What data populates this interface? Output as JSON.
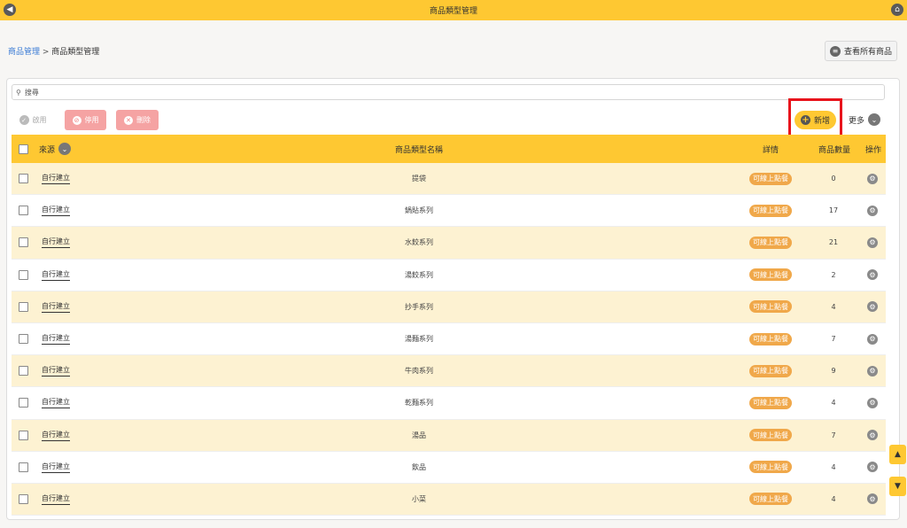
{
  "topbar": {
    "title": "商品類型管理",
    "back_icon": "◀",
    "home_icon": "⌂"
  },
  "breadcrumb": {
    "root": "商品管理",
    "separator": " > ",
    "current": "商品類型管理"
  },
  "view_all_button": {
    "label": "查看所有商品",
    "icon": "≡"
  },
  "search": {
    "placeholder": "搜尋",
    "value": ""
  },
  "toolbar": {
    "enable_label": "啟用",
    "disable_label": "停用",
    "delete_label": "刪除",
    "add_label": "新增",
    "more_label": "更多"
  },
  "table": {
    "headers": {
      "source": "來源",
      "name": "商品類型名稱",
      "detail": "詳情",
      "count": "商品數量",
      "action": "操作"
    },
    "rows": [
      {
        "source": "自行建立",
        "name": "提袋",
        "tag": "可線上點餐",
        "count": "0"
      },
      {
        "source": "自行建立",
        "name": "鍋貼系列",
        "tag": "可線上點餐",
        "count": "17"
      },
      {
        "source": "自行建立",
        "name": "水餃系列",
        "tag": "可線上點餐",
        "count": "21"
      },
      {
        "source": "自行建立",
        "name": "湯餃系列",
        "tag": "可線上點餐",
        "count": "2"
      },
      {
        "source": "自行建立",
        "name": "抄手系列",
        "tag": "可線上點餐",
        "count": "4"
      },
      {
        "source": "自行建立",
        "name": "湯麵系列",
        "tag": "可線上點餐",
        "count": "7"
      },
      {
        "source": "自行建立",
        "name": "牛肉系列",
        "tag": "可線上點餐",
        "count": "9"
      },
      {
        "source": "自行建立",
        "name": "乾麵系列",
        "tag": "可線上點餐",
        "count": "4"
      },
      {
        "source": "自行建立",
        "name": "湯品",
        "tag": "可線上點餐",
        "count": "7"
      },
      {
        "source": "自行建立",
        "name": "飲品",
        "tag": "可線上點餐",
        "count": "4"
      },
      {
        "source": "自行建立",
        "name": "小菜",
        "tag": "可線上點餐",
        "count": "4"
      }
    ]
  },
  "scroll": {
    "up": "▲",
    "down": "▼"
  },
  "colors": {
    "brand": "#fec832",
    "highlight": "#e8141c",
    "tag": "#f0a84a",
    "danger_button": "#f5a3a3",
    "row_alt": "#fdf2d2",
    "link": "#3a7bd5"
  }
}
